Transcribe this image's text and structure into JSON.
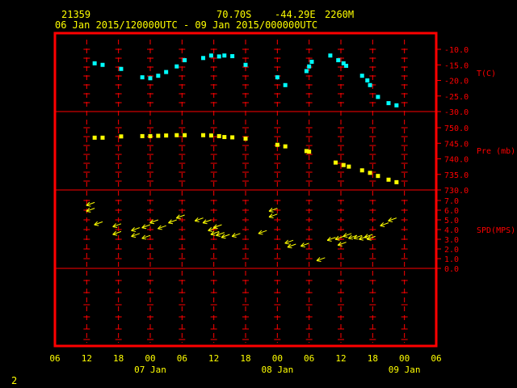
{
  "header": {
    "station": "21359",
    "lat": "70.70S",
    "lon": "-44.29E",
    "elev": "2260M",
    "range": "06 Jan 2015/120000UTC - 09 Jan 2015/000000UTC"
  },
  "footer": {
    "page": "2"
  },
  "colors": {
    "frame": "#ff0000",
    "temp": "#00ffff",
    "pres": "#ffff00",
    "wind": "#ffff00",
    "text": "#ffff00"
  },
  "chart_data": {
    "type": "scatter",
    "x_unit": "hours since 06 Jan 2015 00 UTC",
    "x_ticks": [
      {
        "x": 0,
        "label": "06"
      },
      {
        "x": 6,
        "label": "12"
      },
      {
        "x": 12,
        "label": "18"
      },
      {
        "x": 18,
        "label": "00"
      },
      {
        "x": 24,
        "label": "06"
      },
      {
        "x": 30,
        "label": "12"
      },
      {
        "x": 36,
        "label": "18"
      },
      {
        "x": 42,
        "label": "00"
      },
      {
        "x": 48,
        "label": "06"
      },
      {
        "x": 54,
        "label": "12"
      },
      {
        "x": 60,
        "label": "18"
      },
      {
        "x": 66,
        "label": "00"
      },
      {
        "x": 72,
        "label": "06"
      }
    ],
    "day_labels": [
      {
        "x": 18,
        "label": "07 Jan"
      },
      {
        "x": 42,
        "label": "08 Jan"
      },
      {
        "x": 66,
        "label": "09 Jan"
      }
    ],
    "panels": [
      {
        "name": "T(C)",
        "ylim": [
          -30,
          -10
        ],
        "ticks": [
          "-10.0",
          "-15.0",
          "-20.0",
          "-25.0",
          "-30.0"
        ],
        "tick_values": [
          -10,
          -15,
          -20,
          -25,
          -30
        ],
        "points": [
          [
            7.5,
            -14.5
          ],
          [
            9,
            -15
          ],
          [
            12.5,
            -16.3
          ],
          [
            16.5,
            -19
          ],
          [
            18,
            -19.3
          ],
          [
            19.5,
            -18.5
          ],
          [
            21,
            -17.3
          ],
          [
            23,
            -15.5
          ],
          [
            24.5,
            -13.5
          ],
          [
            28,
            -12.8
          ],
          [
            29.5,
            -12
          ],
          [
            31,
            -12.3
          ],
          [
            32,
            -12
          ],
          [
            33.5,
            -12.2
          ],
          [
            36,
            -15
          ],
          [
            42,
            -19
          ],
          [
            43.5,
            -21.5
          ],
          [
            47.5,
            -17
          ],
          [
            48,
            -15.5
          ],
          [
            48.5,
            -14
          ],
          [
            52,
            -12
          ],
          [
            53.5,
            -13.5
          ],
          [
            54.5,
            -14.5
          ],
          [
            55,
            -15.3
          ],
          [
            58,
            -18.5
          ],
          [
            59,
            -20
          ],
          [
            59.5,
            -21.5
          ],
          [
            61,
            -25.3
          ],
          [
            63,
            -27.3
          ],
          [
            64.5,
            -28
          ]
        ]
      },
      {
        "name": "Pre (mb)",
        "ylim": [
          730,
          750
        ],
        "ticks": [
          "750.0",
          "745.0",
          "740.0",
          "735.0",
          "730.0"
        ],
        "tick_values": [
          750,
          745,
          740,
          735,
          730
        ],
        "points": [
          [
            7.5,
            746.8
          ],
          [
            9,
            746.8
          ],
          [
            12.5,
            747.2
          ],
          [
            16.5,
            747.3
          ],
          [
            18,
            747.3
          ],
          [
            19.5,
            747.4
          ],
          [
            21,
            747.5
          ],
          [
            23,
            747.6
          ],
          [
            24.5,
            747.6
          ],
          [
            28,
            747.6
          ],
          [
            29.5,
            747.5
          ],
          [
            31,
            747.3
          ],
          [
            32,
            747
          ],
          [
            33.5,
            746.9
          ],
          [
            36,
            746.5
          ],
          [
            42,
            744.5
          ],
          [
            43.5,
            744
          ],
          [
            47.5,
            742.5
          ],
          [
            48,
            742.3
          ],
          [
            53,
            738.8
          ],
          [
            54.5,
            738
          ],
          [
            55.5,
            737.5
          ],
          [
            58,
            736.3
          ],
          [
            59.5,
            735.5
          ],
          [
            61,
            734.5
          ],
          [
            63,
            733.3
          ],
          [
            64.5,
            732.5
          ]
        ]
      },
      {
        "name": "SPD(MPS)",
        "ylim": [
          0,
          7
        ],
        "ticks": [
          "7.0",
          "6.0",
          "5.0",
          "4.0",
          "3.0",
          "2.0",
          "1.0",
          "0.0"
        ],
        "tick_values": [
          7,
          6,
          5,
          4,
          3,
          2,
          1,
          0
        ],
        "points": [
          [
            7.5,
            6.8
          ],
          [
            7.5,
            6.2
          ],
          [
            9,
            4.8
          ],
          [
            12.5,
            4.6
          ],
          [
            12.5,
            3.8
          ],
          [
            16,
            4.2
          ],
          [
            16,
            3.6
          ],
          [
            18,
            4.5
          ],
          [
            18,
            3.4
          ],
          [
            19.5,
            5
          ],
          [
            21,
            4.4
          ],
          [
            23,
            5
          ],
          [
            24.5,
            5.5
          ],
          [
            28,
            5.2
          ],
          [
            29.5,
            5
          ],
          [
            30.5,
            4.2
          ],
          [
            31,
            3.8
          ],
          [
            31.5,
            4.5
          ],
          [
            32,
            3.7
          ],
          [
            33,
            3.5
          ],
          [
            35,
            3.6
          ],
          [
            40,
            3.9
          ],
          [
            42,
            6.2
          ],
          [
            42,
            5.6
          ],
          [
            45,
            2.9
          ],
          [
            45.5,
            2.5
          ],
          [
            48,
            2.6
          ],
          [
            51,
            1.1
          ],
          [
            53,
            3.2
          ],
          [
            54.5,
            3.3
          ],
          [
            55,
            2.7
          ],
          [
            56,
            3.6
          ],
          [
            57,
            3.4
          ],
          [
            58,
            3.4
          ],
          [
            59,
            3.3
          ],
          [
            60,
            3.5
          ],
          [
            60.5,
            3.3
          ],
          [
            63,
            4.7
          ],
          [
            64.5,
            5.2
          ]
        ]
      }
    ]
  }
}
